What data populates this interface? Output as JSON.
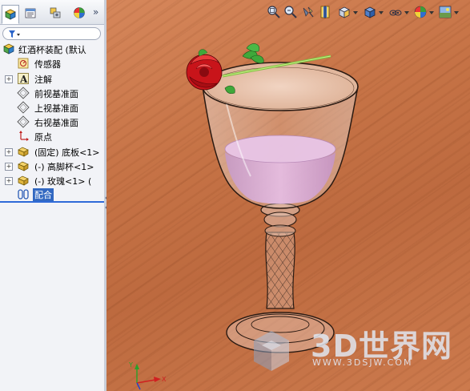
{
  "panel": {
    "tabs": [
      {
        "icon": "feature-manager-icon",
        "active": true
      },
      {
        "icon": "property-manager-icon",
        "active": false
      },
      {
        "icon": "configuration-manager-icon",
        "active": false
      },
      {
        "icon": "display-manager-icon",
        "active": false
      }
    ],
    "more_label": "»",
    "tree": [
      {
        "label": "红酒杯装配  (默认",
        "icon": "assembly-icon",
        "expander": ""
      },
      {
        "label": "传感器",
        "icon": "sensor-icon",
        "expander": ""
      },
      {
        "label": "注解",
        "icon": "annotation-icon",
        "expander": "+"
      },
      {
        "label": "前视基准面",
        "icon": "plane-icon",
        "expander": ""
      },
      {
        "label": "上视基准面",
        "icon": "plane-icon",
        "expander": ""
      },
      {
        "label": "右视基准面",
        "icon": "plane-icon",
        "expander": ""
      },
      {
        "label": "原点",
        "icon": "origin-icon",
        "expander": ""
      },
      {
        "label": "(固定) 底板<1>",
        "icon": "part-icon",
        "expander": "+"
      },
      {
        "label": "(-) 高脚杯<1>",
        "icon": "part-icon",
        "expander": "+"
      },
      {
        "label": "(-) 玫瑰<1> (",
        "icon": "part-icon",
        "expander": "+"
      },
      {
        "label": "配合",
        "icon": "mates-icon",
        "expander": "",
        "selected": true
      }
    ]
  },
  "view_toolbar": [
    "zoom-to-fit-icon",
    "zoom-to-area-icon",
    "previous-view-icon",
    "section-view-icon",
    "view-orientation-icon",
    "display-style-icon",
    "hide-show-icon",
    "edit-appearance-icon",
    "scene-icon"
  ],
  "watermark": {
    "text": "3D世界网",
    "url": "WWW.3DSJW.COM"
  },
  "triad": {
    "x_label": "X",
    "y_label": "Y"
  },
  "colors": {
    "selection": "#3268c1",
    "wood": "#c67346",
    "wine": "#d9a7d4",
    "rose": "#d11a1a"
  }
}
